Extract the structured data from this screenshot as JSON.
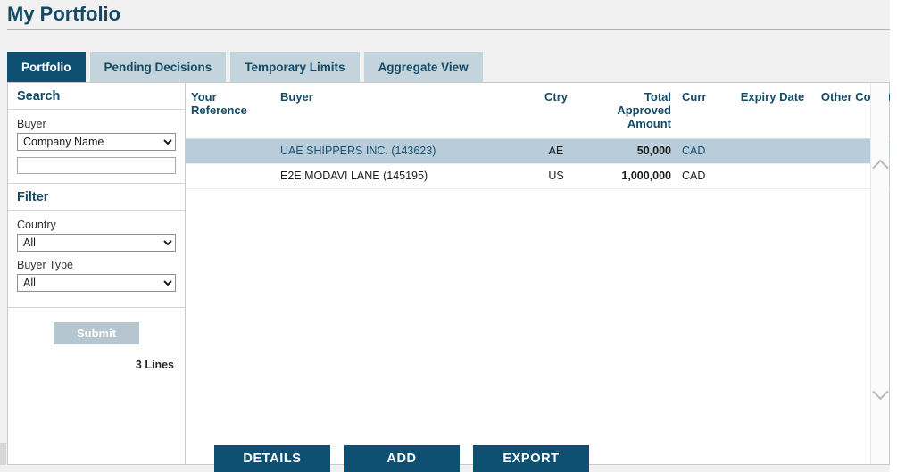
{
  "page": {
    "title": "My Portfolio"
  },
  "tabs": [
    {
      "label": "Portfolio",
      "active": true
    },
    {
      "label": "Pending Decisions",
      "active": false
    },
    {
      "label": "Temporary Limits",
      "active": false
    },
    {
      "label": "Aggregate View",
      "active": false
    }
  ],
  "sidebar": {
    "search": {
      "heading": "Search",
      "buyer_label": "Buyer",
      "buyer_select_value": "Company Name",
      "buyer_select_options": [
        "Company Name"
      ],
      "buyer_input_value": "",
      "buyer_input_placeholder": ""
    },
    "filter": {
      "heading": "Filter",
      "country_label": "Country",
      "country_value": "All",
      "country_options": [
        "All"
      ],
      "buyer_type_label": "Buyer Type",
      "buyer_type_value": "All",
      "buyer_type_options": [
        "All"
      ]
    },
    "submit_label": "Submit",
    "lines_count": "3 Lines"
  },
  "table": {
    "columns": [
      {
        "key": "reference",
        "label": "Your Reference"
      },
      {
        "key": "buyer",
        "label": "Buyer"
      },
      {
        "key": "ctry",
        "label": "Ctry"
      },
      {
        "key": "amount",
        "label": "Total Approved Amount"
      },
      {
        "key": "curr",
        "label": "Curr"
      },
      {
        "key": "expiry",
        "label": "Expiry Date"
      },
      {
        "key": "other",
        "label": "Other Conditions"
      }
    ],
    "rows": [
      {
        "reference": "",
        "buyer": "UAE SHIPPERS INC. (143623)",
        "ctry": "AE",
        "amount": "50,000",
        "curr": "CAD",
        "expiry": "",
        "other": "",
        "selected": true
      },
      {
        "reference": "",
        "buyer": "E2E MODAVI LANE (145195)",
        "ctry": "US",
        "amount": "1,000,000",
        "curr": "CAD",
        "expiry": "",
        "other": "",
        "selected": false
      }
    ]
  },
  "actions": [
    {
      "label": "DETAILS"
    },
    {
      "label": "ADD"
    },
    {
      "label": "EXPORT"
    }
  ],
  "colors": {
    "brand_dark": "#0d5071",
    "brand_text": "#134b66",
    "tab_inactive": "#c3d4dd",
    "row_selected": "#b8cdd9",
    "submit_disabled": "#b5c6d0",
    "page_bg": "#f1f1f1"
  }
}
